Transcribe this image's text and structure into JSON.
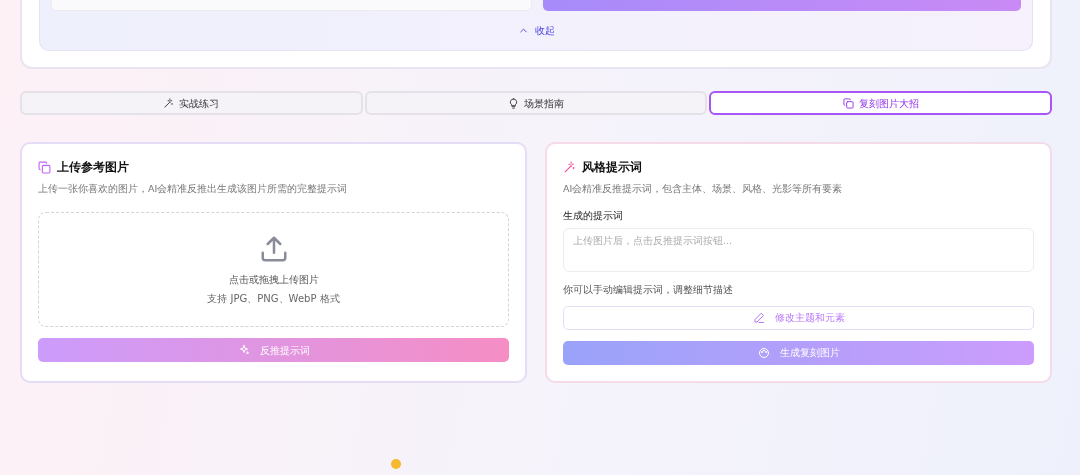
{
  "top_panel": {
    "collapse_link": "收起"
  },
  "tabs": [
    {
      "label": "实战练习",
      "selected": false
    },
    {
      "label": "场景指南",
      "selected": false
    },
    {
      "label": "复刻图片大招",
      "selected": true
    }
  ],
  "upload_card": {
    "title": "上传参考图片",
    "subtitle": "上传一张你喜欢的图片，AI会精准反推出生成该图片所需的完整提示词",
    "dropzone": {
      "prompt": "点击或拖拽上传图片",
      "formats": "支持 JPG、PNG、WebP 格式"
    },
    "button": {
      "label": "反推提示词",
      "disabled": true
    }
  },
  "prompt_card": {
    "title": "风格提示词",
    "subtitle": "AI会精准反推提示词，包含主体、场景、风格、光影等所有要素",
    "field_label": "生成的提示词",
    "placeholder": "上传图片后，点击反推提示词按钮...",
    "hint": "你可以手动编辑提示词，调整细节描述",
    "edit_button": {
      "label": "修改主题和元素",
      "disabled": true
    },
    "generate_button": {
      "label": "生成复刻图片",
      "disabled": true
    }
  }
}
